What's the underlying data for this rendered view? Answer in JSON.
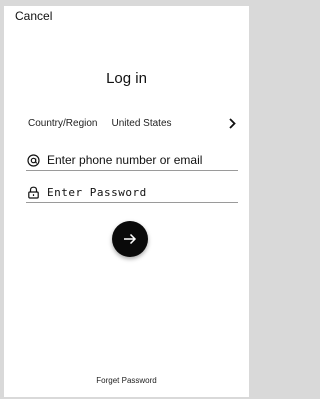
{
  "header": {
    "cancel_label": "Cancel"
  },
  "title": "Log in",
  "region": {
    "label": "Country/Region",
    "value": "United States",
    "chevron_icon": "chevron-right-icon"
  },
  "phone_field": {
    "placeholder": "Enter phone number or email",
    "value": "",
    "icon": "at-sign-icon"
  },
  "password_field": {
    "placeholder": "Enter Password",
    "value": "",
    "icon": "lock-icon"
  },
  "submit": {
    "icon": "arrow-right-icon",
    "color": "#0a0a0a"
  },
  "forget_label": "Forget Password"
}
